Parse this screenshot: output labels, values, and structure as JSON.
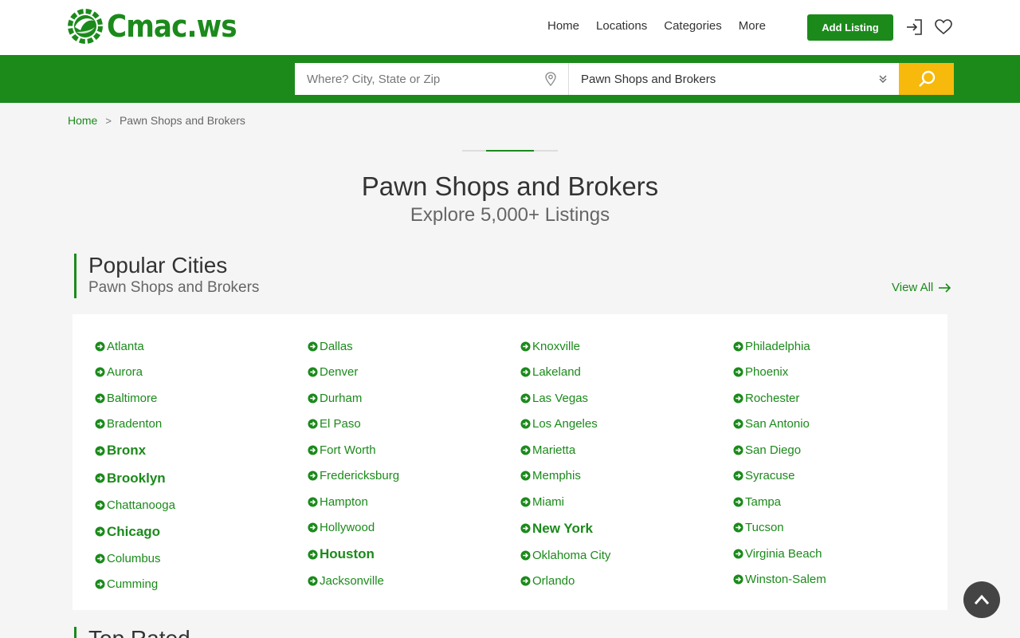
{
  "brand": {
    "name": "Cmac.ws",
    "color": "#1b8a1b"
  },
  "nav": {
    "items": [
      "Home",
      "Locations",
      "Categories",
      "More"
    ],
    "add_listing": "Add Listing"
  },
  "search": {
    "where_placeholder": "Where? City, State or Zip",
    "category_value": "Pawn Shops and Brokers",
    "button_color": "#f6b90c"
  },
  "breadcrumb": {
    "home": "Home",
    "separator": ">",
    "current": "Pawn Shops and Brokers"
  },
  "page": {
    "title": "Pawn Shops and Brokers",
    "subtitle": "Explore 5,000+ Listings"
  },
  "popular": {
    "title": "Popular Cities",
    "subtitle": "Pawn Shops and Brokers",
    "view_all": "View All"
  },
  "cities": {
    "col1": [
      {
        "name": "Atlanta",
        "bold": false
      },
      {
        "name": "Aurora",
        "bold": false
      },
      {
        "name": "Baltimore",
        "bold": false
      },
      {
        "name": "Bradenton",
        "bold": false
      },
      {
        "name": "Bronx",
        "bold": true
      },
      {
        "name": "Brooklyn",
        "bold": true
      },
      {
        "name": "Chattanooga",
        "bold": false
      },
      {
        "name": "Chicago",
        "bold": true
      },
      {
        "name": "Columbus",
        "bold": false
      },
      {
        "name": "Cumming",
        "bold": false
      }
    ],
    "col2": [
      {
        "name": "Dallas",
        "bold": false
      },
      {
        "name": "Denver",
        "bold": false
      },
      {
        "name": "Durham",
        "bold": false
      },
      {
        "name": "El Paso",
        "bold": false
      },
      {
        "name": "Fort Worth",
        "bold": false
      },
      {
        "name": "Fredericksburg",
        "bold": false
      },
      {
        "name": "Hampton",
        "bold": false
      },
      {
        "name": "Hollywood",
        "bold": false
      },
      {
        "name": "Houston",
        "bold": true
      },
      {
        "name": "Jacksonville",
        "bold": false
      }
    ],
    "col3": [
      {
        "name": "Knoxville",
        "bold": false
      },
      {
        "name": "Lakeland",
        "bold": false
      },
      {
        "name": "Las Vegas",
        "bold": false
      },
      {
        "name": "Los Angeles",
        "bold": false
      },
      {
        "name": "Marietta",
        "bold": false
      },
      {
        "name": "Memphis",
        "bold": false
      },
      {
        "name": "Miami",
        "bold": false
      },
      {
        "name": "New York",
        "bold": true
      },
      {
        "name": "Oklahoma City",
        "bold": false
      },
      {
        "name": "Orlando",
        "bold": false
      }
    ],
    "col4": [
      {
        "name": "Philadelphia",
        "bold": false
      },
      {
        "name": "Phoenix",
        "bold": false
      },
      {
        "name": "Rochester",
        "bold": false
      },
      {
        "name": "San Antonio",
        "bold": false
      },
      {
        "name": "San Diego",
        "bold": false
      },
      {
        "name": "Syracuse",
        "bold": false
      },
      {
        "name": "Tampa",
        "bold": false
      },
      {
        "name": "Tucson",
        "bold": false
      },
      {
        "name": "Virginia Beach",
        "bold": false
      },
      {
        "name": "Winston-Salem",
        "bold": false
      }
    ]
  },
  "next_section": {
    "title": "Top Rated"
  }
}
